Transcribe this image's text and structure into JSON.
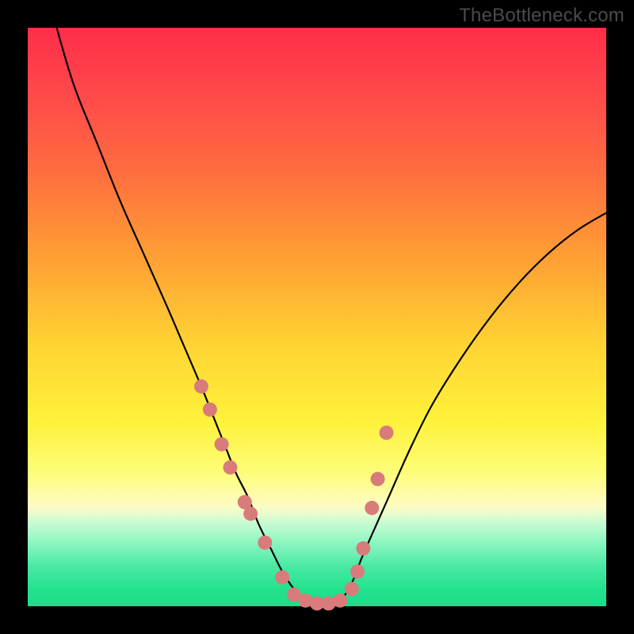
{
  "watermark": "TheBottleneck.com",
  "colors": {
    "background": "#000000",
    "curve_stroke": "#000000",
    "marker_fill": "#d97b7b",
    "marker_stroke": "#c96a6a",
    "gradient_stops": [
      {
        "offset": 0,
        "color": "#ff2d4a"
      },
      {
        "offset": 0.55,
        "color": "#ffd433"
      },
      {
        "offset": 0.83,
        "color": "#fefcc0"
      },
      {
        "offset": 1.0,
        "color": "#1edb88"
      }
    ]
  },
  "chart_data": {
    "type": "line",
    "title": "",
    "xlabel": "",
    "ylabel": "",
    "x_range": [
      0,
      100
    ],
    "y_range": [
      0,
      100
    ],
    "series": [
      {
        "name": "bottleneck-curve",
        "x": [
          5,
          8,
          12,
          16,
          20,
          24,
          27,
          30,
          32,
          34,
          36,
          38,
          40,
          42,
          44,
          46,
          48,
          50,
          52,
          54,
          56,
          58,
          62,
          66,
          70,
          75,
          80,
          85,
          90,
          95,
          100
        ],
        "y": [
          100,
          90,
          80,
          70,
          61,
          52,
          45,
          38,
          33,
          28,
          23,
          19,
          14,
          10,
          6,
          3,
          1,
          0.5,
          0.5,
          1,
          4,
          9,
          18,
          27,
          35,
          43,
          50,
          56,
          61,
          65,
          68
        ]
      }
    ],
    "markers": {
      "name": "highlighted-points",
      "x": [
        30.0,
        31.5,
        33.5,
        35.0,
        37.5,
        38.5,
        41.0,
        44.0,
        46.0,
        48.0,
        50.0,
        52.0,
        54.0,
        56.0,
        57.0,
        58.0,
        59.5,
        60.5,
        62.0
      ],
      "y": [
        38.0,
        34.0,
        28.0,
        24.0,
        18.0,
        16.0,
        11.0,
        5.0,
        2.0,
        1.0,
        0.5,
        0.5,
        1.0,
        3.0,
        6.0,
        10.0,
        17.0,
        22.0,
        30.0
      ]
    }
  }
}
